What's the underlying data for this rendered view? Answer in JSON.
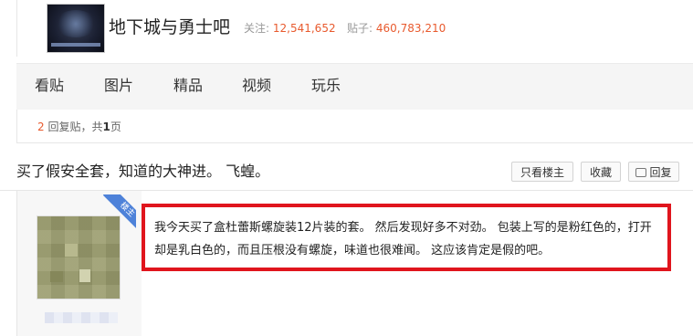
{
  "forum": {
    "name": "地下城与勇士吧",
    "follow_label": "关注:",
    "follow_count": "12,541,652",
    "posts_label": "贴子:",
    "posts_count": "460,783,210"
  },
  "nav": {
    "tabs": [
      {
        "label": "看贴"
      },
      {
        "label": "图片"
      },
      {
        "label": "精品"
      },
      {
        "label": "视频"
      },
      {
        "label": "玩乐"
      }
    ]
  },
  "reply_info": {
    "count": "2",
    "reply_label": "回复贴，共",
    "pages": "1",
    "page_suffix": "页"
  },
  "thread": {
    "title": "买了假安全套，知道的大神进。 飞蝗。",
    "only_op_label": "只看楼主",
    "favorite_label": "收藏",
    "reply_label": "回复"
  },
  "post": {
    "badge": "楼主",
    "body": "我今天买了盒杜蕾斯螺旋装12片装的套。 然后发现好多不对劲。 包装上写的是粉红色的，打开却是乳白色的，而且压根没有螺旋，味道也很难闻。 这应该肯定是假的吧。"
  },
  "icons": {
    "reply": "speech-bubble-icon"
  },
  "colors": {
    "accent": "#e85a2e",
    "highlight_border": "#e0151d",
    "badge": "#4e82d9"
  }
}
